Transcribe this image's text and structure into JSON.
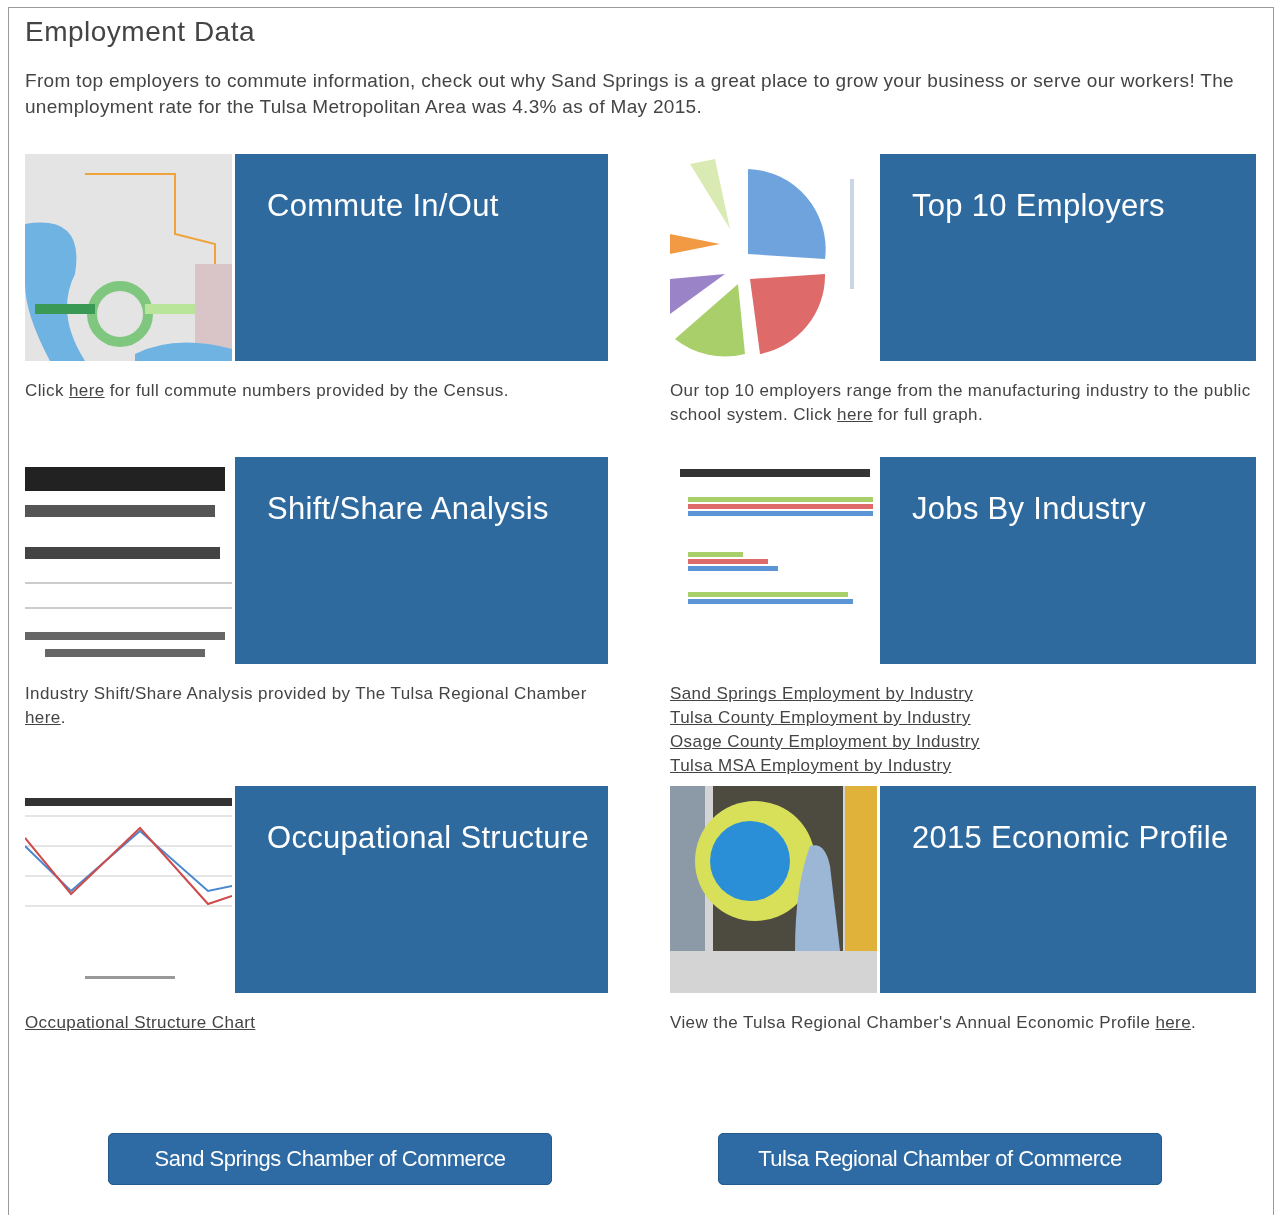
{
  "title": "Employment Data",
  "intro": "From top employers to commute information, check out why Sand Springs is a great place to grow your business or serve our workers! The unemployment rate for the Tulsa Metropolitan Area was 4.3% as of May 2015.",
  "cards": [
    {
      "title": "Commute In/Out",
      "thumbnail": {
        "kind": "picture"
      },
      "caption": [
        {
          "kind": "text",
          "parts": [
            {
              "text": "Click "
            },
            {
              "text": "here",
              "link": true
            },
            {
              "text": " for full commute numbers provided by the Census."
            }
          ]
        }
      ]
    },
    {
      "title": "Top 10 Employers",
      "thumbnail": {
        "kind": "picture"
      },
      "caption": [
        {
          "kind": "text",
          "parts": [
            {
              "text": "Our top 10 employers range from the manufacturing industry to the public school system. Click "
            },
            {
              "text": "here",
              "link": true
            },
            {
              "text": " for full graph."
            }
          ]
        }
      ]
    },
    {
      "title": "Shift/Share Analysis",
      "thumbnail": {
        "kind": "picture"
      },
      "caption": [
        {
          "kind": "text",
          "parts": [
            {
              "text": "Industry Shift/Share Analysis provided by The Tulsa Regional Chamber "
            },
            {
              "text": "here",
              "link": true
            },
            {
              "text": "."
            }
          ]
        }
      ]
    },
    {
      "title": "Jobs By Industry",
      "thumbnail": {
        "kind": "picture"
      },
      "caption": [
        {
          "kind": "link",
          "text": "Sand Springs Employment by Industry"
        },
        {
          "kind": "link",
          "text": "Tulsa County Employment by Industry"
        },
        {
          "kind": "link",
          "text": "Osage County Employment by Industry"
        },
        {
          "kind": "link",
          "text": "Tulsa MSA Employment by Industry"
        }
      ]
    },
    {
      "title": "Occupational Structure",
      "thumbnail": {
        "kind": "picture"
      },
      "caption": [
        {
          "kind": "link",
          "text": "Occupational Structure Chart"
        }
      ]
    },
    {
      "title": "2015 Economic Profile",
      "thumbnail": {
        "kind": "picture"
      },
      "caption": [
        {
          "kind": "text",
          "parts": [
            {
              "text": "View the Tulsa Regional Chamber's Annual Economic Profile "
            },
            {
              "text": "here",
              "link": true
            },
            {
              "text": "."
            }
          ]
        }
      ]
    }
  ],
  "buttons": [
    "Sand Springs Chamber of Commerce",
    "Tulsa Regional Chamber of Commerce"
  ]
}
